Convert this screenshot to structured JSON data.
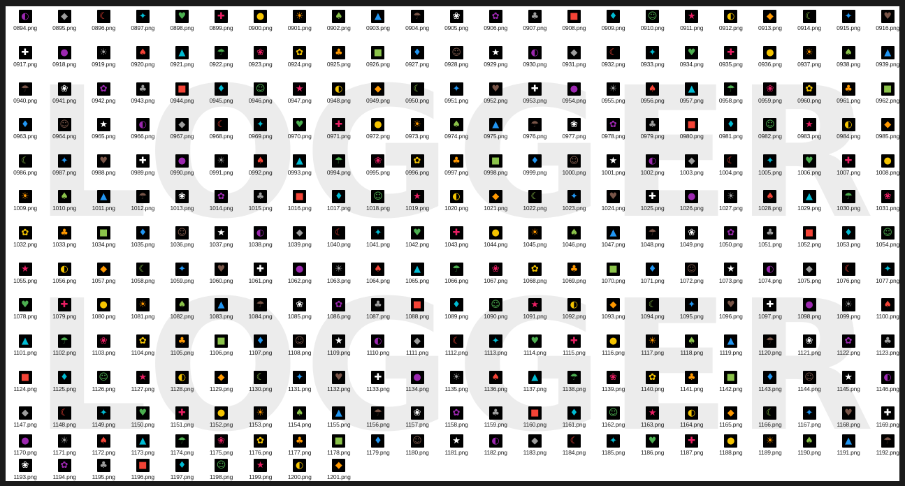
{
  "watermark_text": "LOGGER",
  "grid": {
    "first_number": 894,
    "last_number": 1201,
    "extension": ".png",
    "columns": 23
  },
  "colors": {
    "page_background": "#1b1b1b",
    "explorer_background": "#ffffff",
    "watermark": "#ececec",
    "thumb_background": "#000000",
    "glyph_palette": [
      "#f5c400",
      "#ffffff",
      "#4caf50",
      "#2196f3",
      "#f44336",
      "#ff9800",
      "#9c27b0",
      "#e91e63",
      "#795548",
      "#00bcd4",
      "#8bc34a",
      "#9e9e9e"
    ]
  },
  "thumbnails": {
    "icon": "emoji-thumbnail-icon",
    "glyphs": [
      "●",
      "◆",
      "■",
      "▲",
      "♥",
      "★",
      "✿",
      "☀",
      "☾",
      "♦",
      "☂",
      "✚",
      "◐",
      "♣",
      "♠",
      "✦",
      "☺",
      "❀"
    ]
  }
}
